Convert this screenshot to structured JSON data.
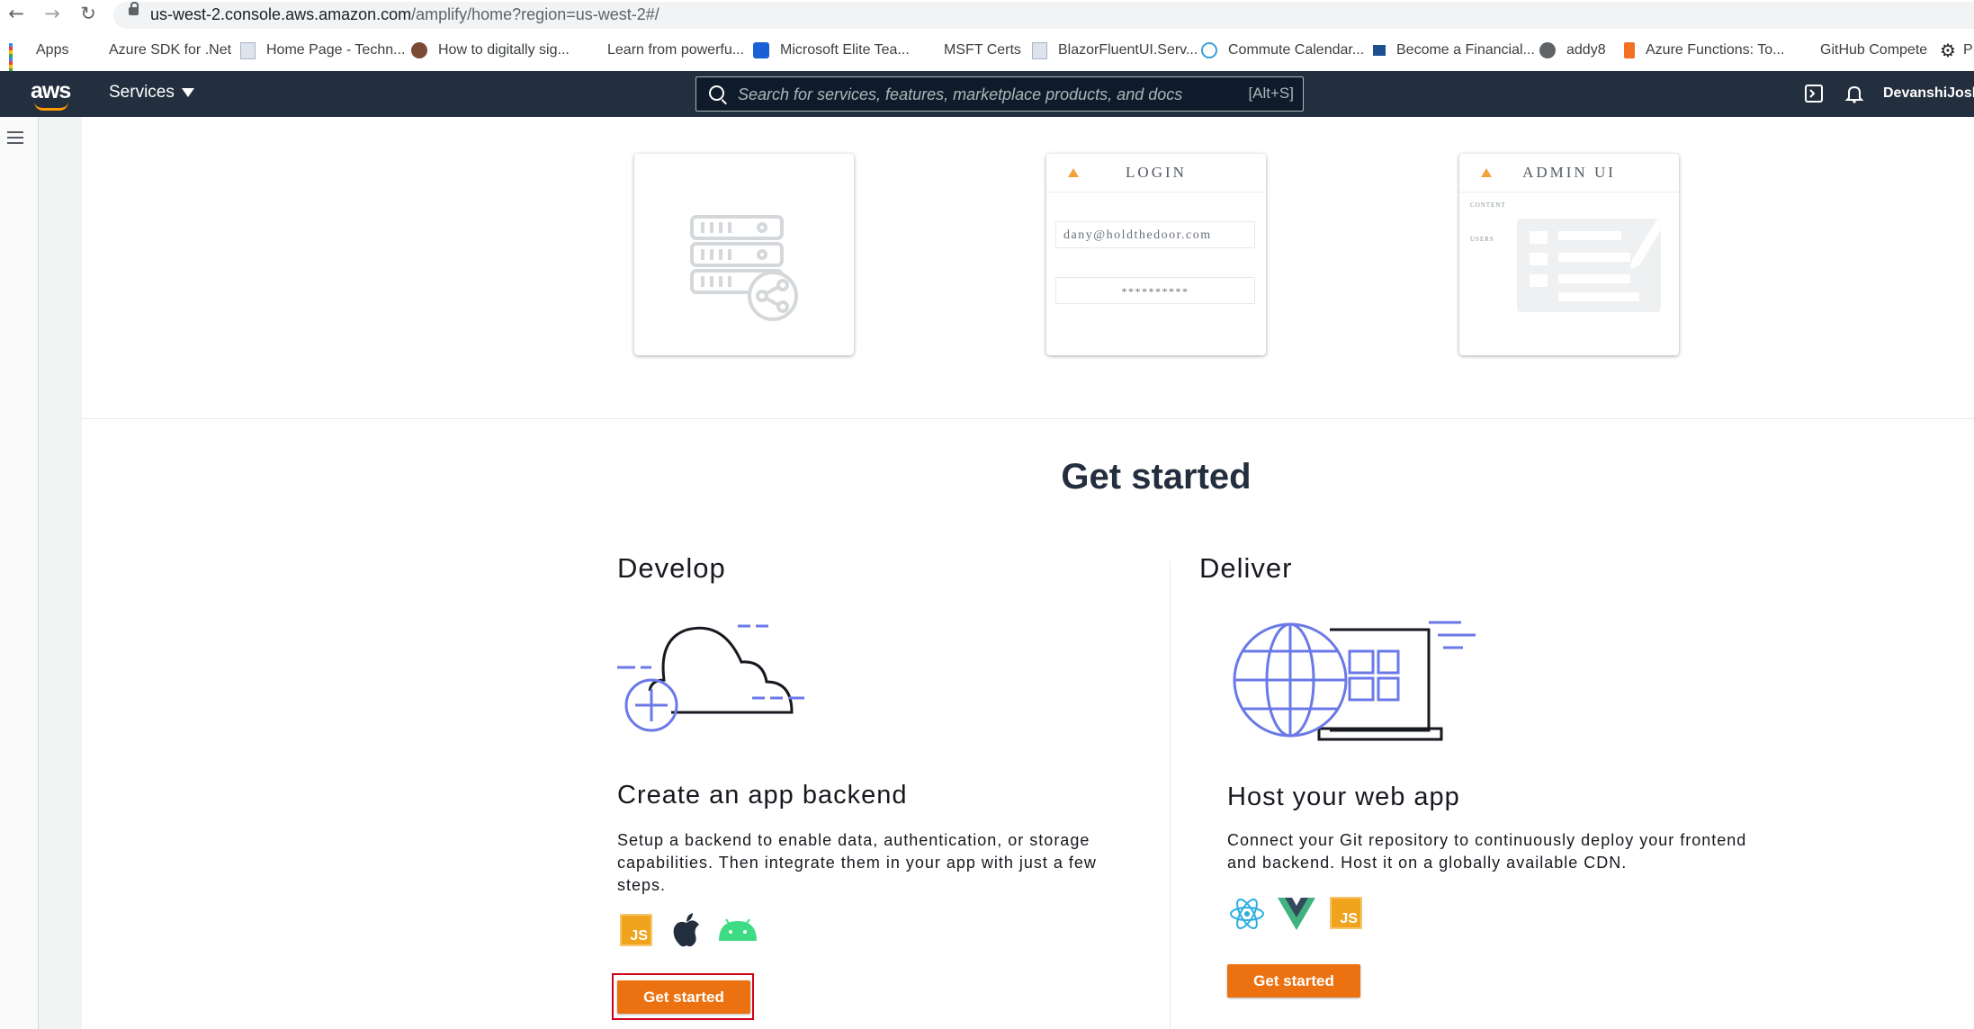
{
  "browser": {
    "url_main": "us-west-2.console.aws.amazon.com",
    "url_rest": "/amplify/home?region=us-west-2#/"
  },
  "bookmarks": [
    {
      "label": "Apps"
    },
    {
      "label": "Azure SDK for .Net"
    },
    {
      "label": "Home Page - Techn..."
    },
    {
      "label": "How to digitally sig..."
    },
    {
      "label": "Learn from powerfu..."
    },
    {
      "label": "Microsoft Elite Tea..."
    },
    {
      "label": "MSFT Certs"
    },
    {
      "label": "BlazorFluentUI.Serv..."
    },
    {
      "label": "Commute Calendar..."
    },
    {
      "label": "Become a Financial..."
    },
    {
      "label": "addy8"
    },
    {
      "label": "Azure Functions: To..."
    },
    {
      "label": "GitHub Compete"
    },
    {
      "label": "P"
    }
  ],
  "aws_header": {
    "logo": "aws",
    "services_label": "Services",
    "search_placeholder": "Search for services, features, marketplace products, and docs",
    "search_shortcut": "[Alt+S]",
    "user": "DevanshiJoshi"
  },
  "feature_cards": {
    "login": {
      "title": "LOGIN",
      "email": "dany@holdthedoor.com",
      "password": "**********"
    },
    "admin_ui": {
      "title": "ADMIN UI",
      "side_items": [
        "CONTENT",
        "USERS"
      ]
    }
  },
  "get_started": {
    "title": "Get started",
    "develop": {
      "heading": "Develop",
      "title": "Create an app backend",
      "description": "Setup a backend to enable data, authentication, or storage capabilities. Then integrate them in your app with just a few steps.",
      "platform_icons": [
        "javascript-icon",
        "apple-icon",
        "android-icon"
      ],
      "button": "Get started"
    },
    "deliver": {
      "heading": "Deliver",
      "title": "Host your web app",
      "description": "Connect your Git repository to continuously deploy your frontend and backend. Host it on a globally available CDN.",
      "platform_icons": [
        "react-icon",
        "vue-icon",
        "javascript-icon"
      ],
      "button": "Get started"
    }
  },
  "colors": {
    "aws_header": "#232f3e",
    "accent_orange": "#ec7211",
    "illustration_blue": "#6b79e8",
    "highlight_red": "#d0021b"
  }
}
